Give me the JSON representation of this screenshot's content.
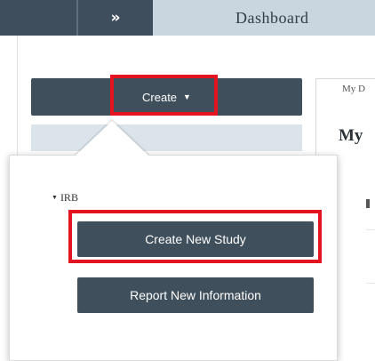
{
  "topbar": {
    "expand_glyph": "»",
    "title": "Dashboard"
  },
  "sidebar": {
    "create_label": "Create",
    "create_caret": "▼"
  },
  "main": {
    "tab_label": "My D",
    "heading": "My"
  },
  "dropdown": {
    "section_caret": "▼",
    "section_label": "IRB",
    "items": [
      {
        "label": "Create New Study"
      },
      {
        "label": "Report New Information"
      }
    ]
  },
  "colors": {
    "button_bg": "#3f4f5c",
    "topbar_bg": "#c9d5df",
    "highlight": "#e3141f"
  }
}
